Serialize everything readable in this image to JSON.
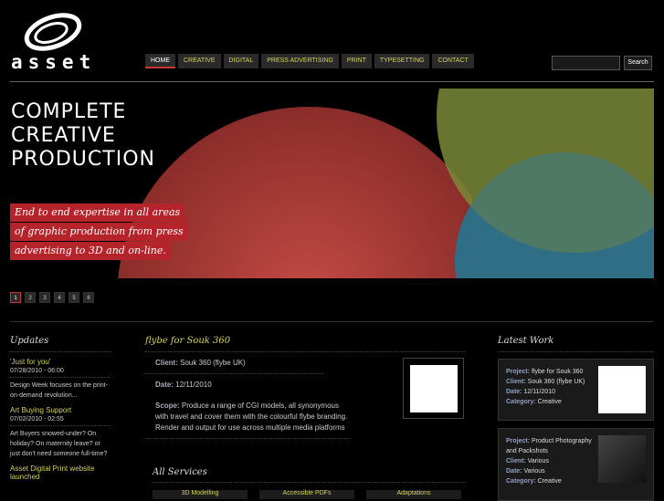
{
  "brand": {
    "name": "asset"
  },
  "nav": [
    "HOME",
    "CREATIVE",
    "DIGITAL",
    "PRESS ADVERTISING",
    "PRINT",
    "TYPESETTING",
    "CONTACT"
  ],
  "search": {
    "value": "",
    "button": "Search"
  },
  "hero": {
    "title": [
      "COMPLETE",
      "CREATIVE",
      "PRODUCTION"
    ],
    "tagline": [
      "End to end expertise in all areas",
      "of graphic production from press",
      "advertising to 3D and on-line."
    ],
    "pages": [
      "1",
      "2",
      "3",
      "4",
      "5",
      "6"
    ],
    "active_page": 1
  },
  "updates": {
    "heading": "Updates",
    "items": [
      {
        "title": "'Just for you'",
        "date": "07/28/2010 - 06:00",
        "text": "Design Week focuses on the print-on-demand revolution..."
      },
      {
        "title": "Art Buying Support",
        "date": "07/02/2010 - 02:55",
        "text": "Art Buyers snowed-under? On holiday? On maternity leave? or just don't need someone full-time?"
      },
      {
        "title": "Asset Digital Print website launched",
        "date": "",
        "text": ""
      }
    ]
  },
  "project": {
    "title": "flybe for Souk 360",
    "client_label": "Client:",
    "client": "Souk 360 (flybe UK)",
    "date_label": "Date:",
    "date": "12/11/2010",
    "scope_label": "Scope:",
    "scope": "Produce a range of CGI models, all synonymous with travel and cover them with the colourful flybe branding. Render and output for use across multiple media platforms"
  },
  "services": {
    "heading": "All Services",
    "items": [
      "3D Modelling",
      "Accessible PDFs",
      "Adaptations"
    ]
  },
  "latest": {
    "heading": "Latest Work",
    "labels": {
      "project": "Project:",
      "client": "Client:",
      "date": "Date:",
      "category": "Category:"
    },
    "items": [
      {
        "project": "flybe for Souk 360",
        "client": "Souk 360 (flybe UK)",
        "date": "12/11/2010",
        "category": "Creative"
      },
      {
        "project": "Product Photography and Packshots",
        "client": "Various",
        "date": "Various",
        "category": "Creative"
      }
    ]
  }
}
